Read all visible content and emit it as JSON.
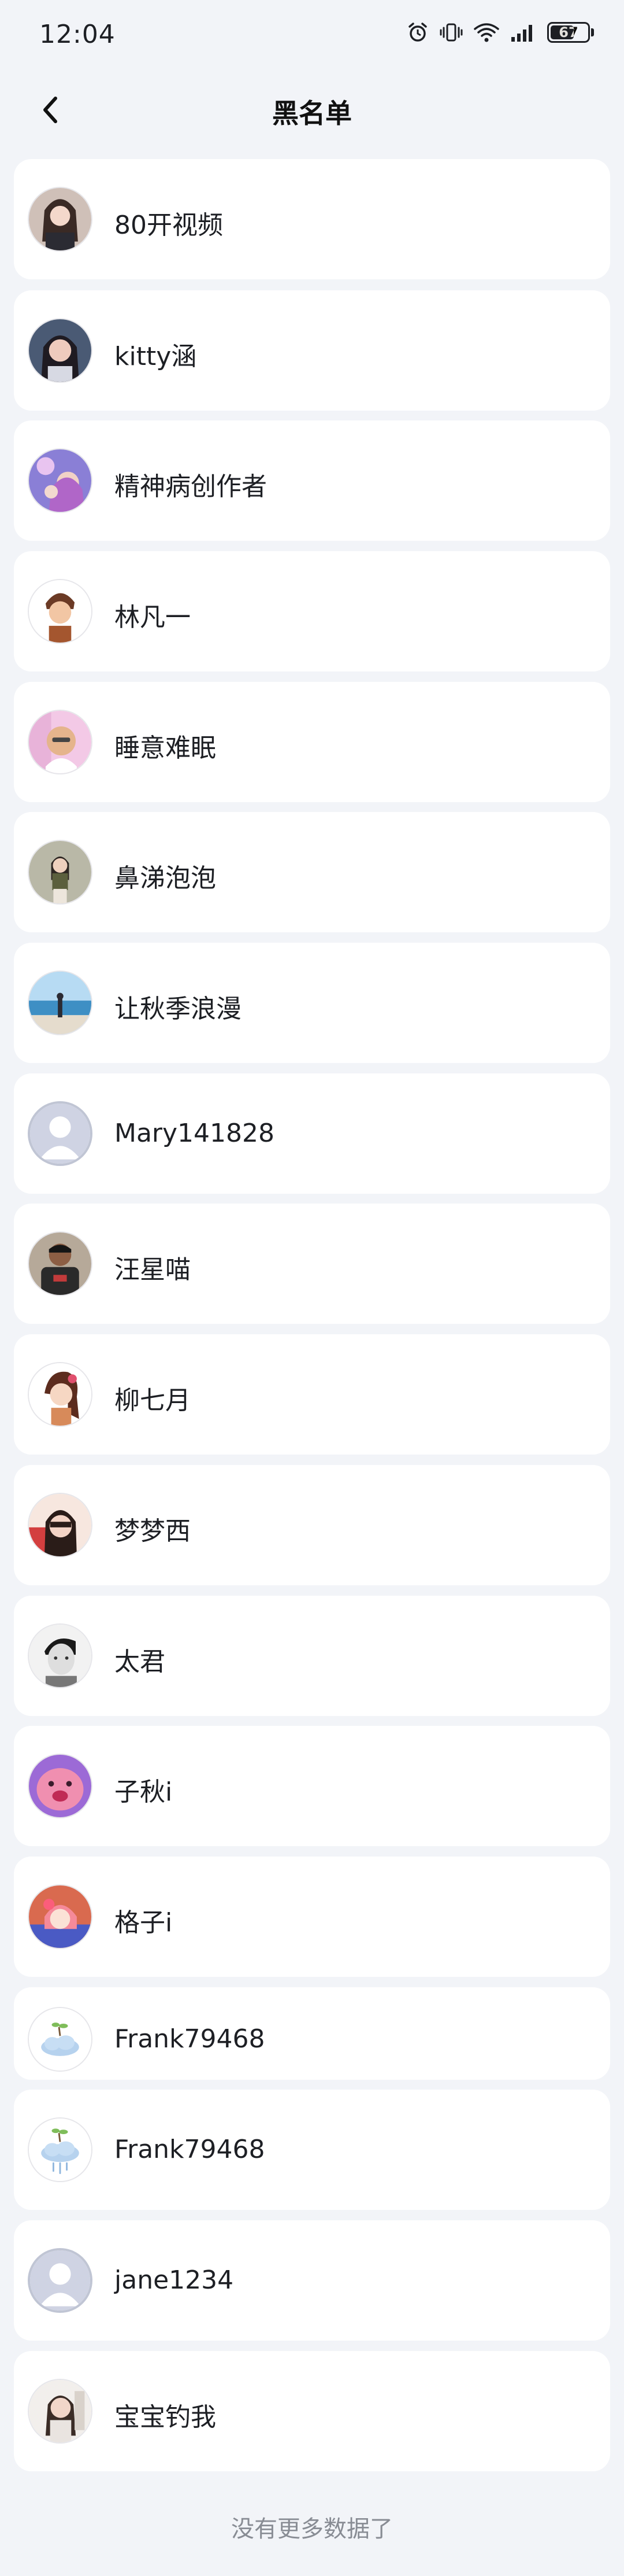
{
  "status_bar": {
    "time": "12:04",
    "battery": "67",
    "battery_level": 0.67
  },
  "nav": {
    "title": "黑名单",
    "back_icon": "chevron-left-icon"
  },
  "blocked_users": [
    {
      "name": "80开视频",
      "avatar": "photo"
    },
    {
      "name": "kitty涵",
      "avatar": "photo"
    },
    {
      "name": "精神病创作者",
      "avatar": "photo"
    },
    {
      "name": "林凡一",
      "avatar": "cartoon"
    },
    {
      "name": "睡意难眠",
      "avatar": "photo"
    },
    {
      "name": "鼻涕泡泡",
      "avatar": "photo"
    },
    {
      "name": "让秋季浪漫",
      "avatar": "photo"
    },
    {
      "name": "Mary141828",
      "avatar": "default-avatar-icon"
    },
    {
      "name": "汪星喵",
      "avatar": "photo"
    },
    {
      "name": "柳七月",
      "avatar": "cartoon"
    },
    {
      "name": "梦梦西",
      "avatar": "photo"
    },
    {
      "name": "太君",
      "avatar": "photo"
    },
    {
      "name": "子秋i",
      "avatar": "cartoon"
    },
    {
      "name": "格子i",
      "avatar": "cartoon"
    },
    {
      "name": "Frank79468",
      "avatar": "cartoon"
    },
    {
      "name": "Frank79468",
      "avatar": "cartoon"
    },
    {
      "name": "jane1234",
      "avatar": "default-avatar-icon"
    },
    {
      "name": "宝宝钓我",
      "avatar": "photo"
    }
  ],
  "footer": {
    "text": "没有更多数据了"
  }
}
